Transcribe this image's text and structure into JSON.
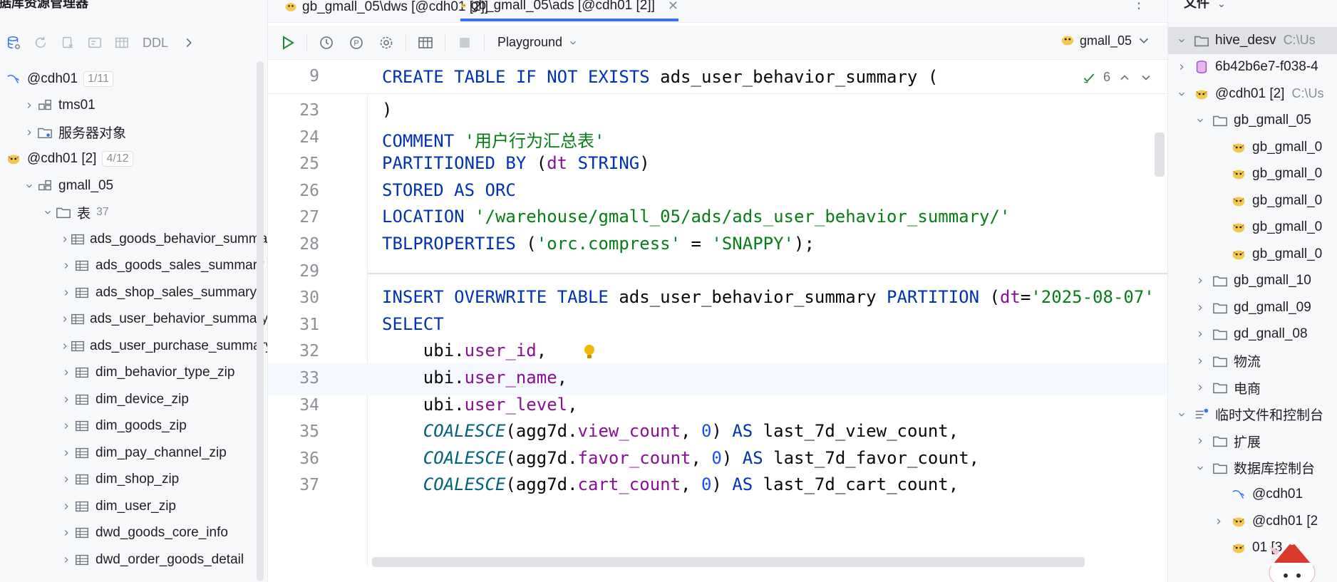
{
  "left_panel": {
    "title": "据库资源管理器",
    "toolbar": {
      "ddl_label": "DDL"
    },
    "tree": [
      {
        "label": "@cdh01",
        "badge": "1/11",
        "icon": "mysql-icon",
        "indent": 0,
        "chevron": "none"
      },
      {
        "label": "tms01",
        "icon": "schema-icon",
        "indent": 1,
        "chevron": "right"
      },
      {
        "label": "服务器对象",
        "icon": "folder-gear-icon",
        "indent": 1,
        "chevron": "right"
      },
      {
        "label": "@cdh01 [2]",
        "badge": "4/12",
        "icon": "hive-icon",
        "indent": 0,
        "chevron": "none"
      },
      {
        "label": "gmall_05",
        "icon": "schema-icon",
        "indent": 1,
        "chevron": "down"
      },
      {
        "label": "表",
        "count": "37",
        "icon": "folder-icon",
        "indent": 2,
        "chevron": "down"
      },
      {
        "label": "ads_goods_behavior_summary",
        "icon": "table-icon",
        "indent": 3,
        "chevron": "right"
      },
      {
        "label": "ads_goods_sales_summary",
        "icon": "table-icon",
        "indent": 3,
        "chevron": "right"
      },
      {
        "label": "ads_shop_sales_summary",
        "icon": "table-icon",
        "indent": 3,
        "chevron": "right"
      },
      {
        "label": "ads_user_behavior_summary",
        "icon": "table-icon",
        "indent": 3,
        "chevron": "right"
      },
      {
        "label": "ads_user_purchase_summary",
        "icon": "table-icon",
        "indent": 3,
        "chevron": "right"
      },
      {
        "label": "dim_behavior_type_zip",
        "icon": "table-icon",
        "indent": 3,
        "chevron": "right"
      },
      {
        "label": "dim_device_zip",
        "icon": "table-icon",
        "indent": 3,
        "chevron": "right"
      },
      {
        "label": "dim_goods_zip",
        "icon": "table-icon",
        "indent": 3,
        "chevron": "right"
      },
      {
        "label": "dim_pay_channel_zip",
        "icon": "table-icon",
        "indent": 3,
        "chevron": "right"
      },
      {
        "label": "dim_shop_zip",
        "icon": "table-icon",
        "indent": 3,
        "chevron": "right"
      },
      {
        "label": "dim_user_zip",
        "icon": "table-icon",
        "indent": 3,
        "chevron": "right"
      },
      {
        "label": "dwd_goods_core_info",
        "icon": "table-icon",
        "indent": 3,
        "chevron": "right"
      },
      {
        "label": "dwd_order_goods_detail",
        "icon": "table-icon",
        "indent": 3,
        "chevron": "right"
      }
    ]
  },
  "tabs": [
    {
      "label": "gb_gmall_05\\dws [@cdh01 [2]]",
      "active": false
    },
    {
      "label": "gb_gmall_05\\ads [@cdh01 [2]]",
      "active": true
    }
  ],
  "editor_toolbar": {
    "mode_label": "Playground",
    "schema_label": "gmall_05"
  },
  "inspections": {
    "count": "6"
  },
  "sticky_line": {
    "number": "9",
    "tokens": [
      {
        "t": "CREATE TABLE IF NOT EXISTS ",
        "c": "kw"
      },
      {
        "t": "ads_user_behavior_summary (",
        "c": ""
      }
    ]
  },
  "code_lines": [
    {
      "number": "23",
      "tokens": [
        {
          "t": ")",
          "c": ""
        }
      ]
    },
    {
      "number": "24",
      "tokens": [
        {
          "t": "COMMENT ",
          "c": "kw"
        },
        {
          "t": "'用户行为汇总表'",
          "c": "str"
        }
      ]
    },
    {
      "number": "25",
      "tokens": [
        {
          "t": "PARTITIONED BY ",
          "c": "kw"
        },
        {
          "t": "(",
          "c": ""
        },
        {
          "t": "dt ",
          "c": "fld"
        },
        {
          "t": "STRING",
          "c": "kw"
        },
        {
          "t": ")",
          "c": ""
        }
      ]
    },
    {
      "number": "26",
      "tokens": [
        {
          "t": "STORED AS ORC",
          "c": "kw"
        }
      ]
    },
    {
      "number": "27",
      "tokens": [
        {
          "t": "LOCATION ",
          "c": "kw"
        },
        {
          "t": "'/warehouse/gmall_05/ads/ads_user_behavior_summary/'",
          "c": "str"
        }
      ]
    },
    {
      "number": "28",
      "tokens": [
        {
          "t": "TBLPROPERTIES ",
          "c": "kw"
        },
        {
          "t": "(",
          "c": ""
        },
        {
          "t": "'orc.compress'",
          "c": "str"
        },
        {
          "t": " = ",
          "c": ""
        },
        {
          "t": "'SNAPPY'",
          "c": "str"
        },
        {
          "t": ");",
          "c": ""
        }
      ]
    },
    {
      "number": "29",
      "tokens": []
    },
    {
      "number": "30",
      "tokens": [
        {
          "t": "INSERT OVERWRITE TABLE ",
          "c": "kw"
        },
        {
          "t": "ads_user_behavior_summary ",
          "c": ""
        },
        {
          "t": "PARTITION ",
          "c": "kw"
        },
        {
          "t": "(",
          "c": ""
        },
        {
          "t": "dt",
          "c": "fld"
        },
        {
          "t": "=",
          "c": ""
        },
        {
          "t": "'2025-08-07'",
          "c": "str"
        }
      ]
    },
    {
      "number": "31",
      "tokens": [
        {
          "t": "SELECT",
          "c": "kw"
        }
      ]
    },
    {
      "number": "32",
      "tokens": [
        {
          "t": "    ubi.",
          "c": ""
        },
        {
          "t": "user_id",
          "c": "fld"
        },
        {
          "t": ",",
          "c": ""
        }
      ]
    },
    {
      "number": "33",
      "tokens": [
        {
          "t": "    ubi.",
          "c": ""
        },
        {
          "t": "user_name",
          "c": "fld"
        },
        {
          "t": ",",
          "c": ""
        }
      ]
    },
    {
      "number": "34",
      "tokens": [
        {
          "t": "    ubi.",
          "c": ""
        },
        {
          "t": "user_level",
          "c": "fld"
        },
        {
          "t": ",",
          "c": ""
        }
      ]
    },
    {
      "number": "35",
      "tokens": [
        {
          "t": "    ",
          "c": ""
        },
        {
          "t": "COALESCE",
          "c": "fn"
        },
        {
          "t": "(agg7d.",
          "c": ""
        },
        {
          "t": "view_count",
          "c": "fld"
        },
        {
          "t": ", ",
          "c": ""
        },
        {
          "t": "0",
          "c": "num"
        },
        {
          "t": ") ",
          "c": ""
        },
        {
          "t": "AS ",
          "c": "kw"
        },
        {
          "t": "last_7d_view_count,",
          "c": ""
        }
      ]
    },
    {
      "number": "36",
      "tokens": [
        {
          "t": "    ",
          "c": ""
        },
        {
          "t": "COALESCE",
          "c": "fn"
        },
        {
          "t": "(agg7d.",
          "c": ""
        },
        {
          "t": "favor_count",
          "c": "fld"
        },
        {
          "t": ", ",
          "c": ""
        },
        {
          "t": "0",
          "c": "num"
        },
        {
          "t": ") ",
          "c": ""
        },
        {
          "t": "AS ",
          "c": "kw"
        },
        {
          "t": "last_7d_favor_count,",
          "c": ""
        }
      ]
    },
    {
      "number": "37",
      "tokens": [
        {
          "t": "    ",
          "c": ""
        },
        {
          "t": "COALESCE",
          "c": "fn"
        },
        {
          "t": "(agg7d.",
          "c": ""
        },
        {
          "t": "cart_count",
          "c": "fld"
        },
        {
          "t": ", ",
          "c": ""
        },
        {
          "t": "0",
          "c": "num"
        },
        {
          "t": ") ",
          "c": ""
        },
        {
          "t": "AS ",
          "c": "kw"
        },
        {
          "t": "last_7d_cart_count,",
          "c": ""
        }
      ]
    }
  ],
  "right_panel": {
    "title": "文件",
    "tree": [
      {
        "label": "hive_desv",
        "path": "C:\\Us",
        "icon": "folder-icon",
        "indent": 0,
        "chevron": "down",
        "selected": true
      },
      {
        "label": "6b42b6e7-f038-4",
        "icon": "database-icon",
        "indent": 0,
        "chevron": "right"
      },
      {
        "label": "@cdh01 [2]",
        "path": "C:\\Us",
        "icon": "hive-icon",
        "indent": 0,
        "chevron": "down"
      },
      {
        "label": "gb_gmall_05",
        "icon": "folder-icon",
        "indent": 1,
        "chevron": "down"
      },
      {
        "label": "gb_gmall_0",
        "icon": "hive-icon",
        "indent": 2,
        "chevron": "none"
      },
      {
        "label": "gb_gmall_0",
        "icon": "hive-icon",
        "indent": 2,
        "chevron": "none"
      },
      {
        "label": "gb_gmall_0",
        "icon": "hive-icon",
        "indent": 2,
        "chevron": "none"
      },
      {
        "label": "gb_gmall_0",
        "icon": "hive-icon",
        "indent": 2,
        "chevron": "none"
      },
      {
        "label": "gb_gmall_0",
        "icon": "hive-icon",
        "indent": 2,
        "chevron": "none"
      },
      {
        "label": "gb_gmall_10",
        "icon": "folder-icon",
        "indent": 1,
        "chevron": "right"
      },
      {
        "label": "gd_gmall_09",
        "icon": "folder-icon",
        "indent": 1,
        "chevron": "right"
      },
      {
        "label": "gd_gnall_08",
        "icon": "folder-icon",
        "indent": 1,
        "chevron": "right"
      },
      {
        "label": "物流",
        "icon": "folder-icon",
        "indent": 1,
        "chevron": "right"
      },
      {
        "label": "电商",
        "icon": "folder-icon",
        "indent": 1,
        "chevron": "right"
      },
      {
        "label": "临时文件和控制台",
        "icon": "scratches-icon",
        "indent": 0,
        "chevron": "down"
      },
      {
        "label": "扩展",
        "icon": "folder-icon",
        "indent": 1,
        "chevron": "right"
      },
      {
        "label": "数据库控制台",
        "icon": "folder-icon",
        "indent": 1,
        "chevron": "down"
      },
      {
        "label": "@cdh01",
        "icon": "mysql-icon",
        "indent": 2,
        "chevron": "none"
      },
      {
        "label": "@cdh01 [2",
        "icon": "hive-icon",
        "indent": 2,
        "chevron": "right"
      },
      {
        "label": "01 [3",
        "icon": "hive-icon",
        "indent": 2,
        "chevron": "none"
      }
    ]
  },
  "colors": {
    "keyword": "#0033b3",
    "string": "#067d17",
    "field": "#871094",
    "number": "#1750eb",
    "function": "#00627a",
    "accent": "#3574f0"
  }
}
